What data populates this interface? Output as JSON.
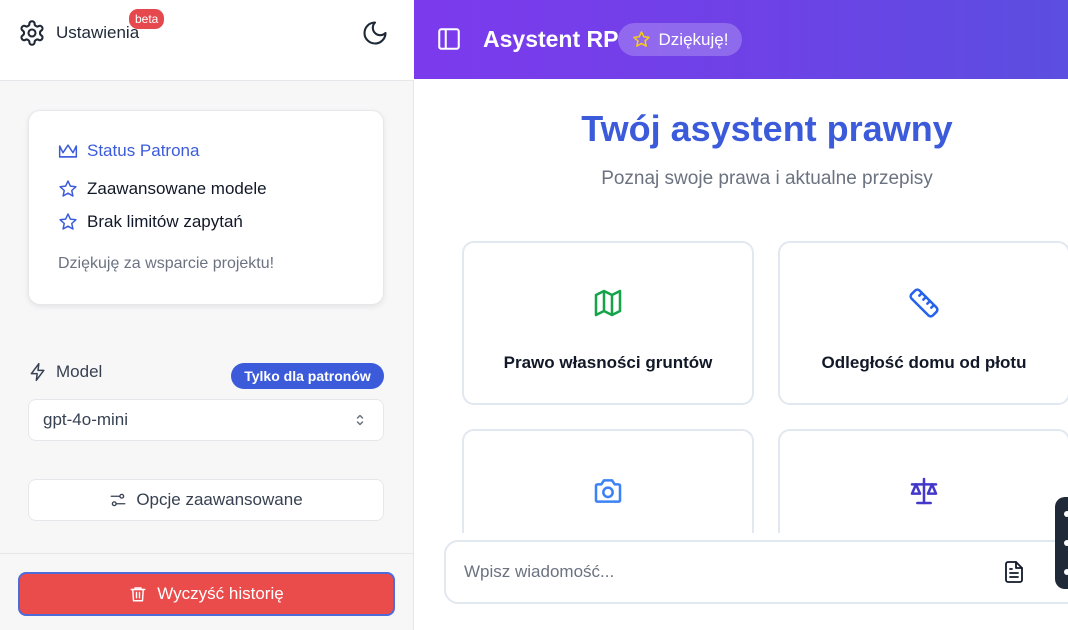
{
  "sidebar": {
    "settings_label": "Ustawienia",
    "beta_label": "beta",
    "patron_card": {
      "status_title": "Status Patrona",
      "features": [
        "Zaawansowane modele",
        "Brak limitów zapytań"
      ],
      "thanks_text": "Dziękuję za wsparcie projektu!"
    },
    "model": {
      "label": "Model",
      "badge": "Tylko dla patronów",
      "selected": "gpt-4o-mini"
    },
    "advanced_label": "Opcje zaawansowane",
    "clear_label": "Wyczyść historię"
  },
  "header": {
    "title": "Asystent RP",
    "thanks_button": "Dziękuję!"
  },
  "main": {
    "hero_title": "Twój asystent prawny",
    "hero_subtitle": "Poznaj swoje prawa i aktualne przepisy",
    "cards": [
      {
        "label": "Prawo własności gruntów",
        "icon": "map-icon"
      },
      {
        "label": "Odległość domu od płotu",
        "icon": "ruler-icon"
      },
      {
        "label": "",
        "icon": "camera-icon"
      },
      {
        "label": "",
        "icon": "scale-icon"
      }
    ],
    "input_placeholder": "Wpisz wiadomość..."
  },
  "colors": {
    "accent": "#3b5bdb",
    "danger": "#ea4c4c",
    "header_gradient_start": "#7c3aed",
    "header_gradient_end": "#5b4ee0"
  }
}
